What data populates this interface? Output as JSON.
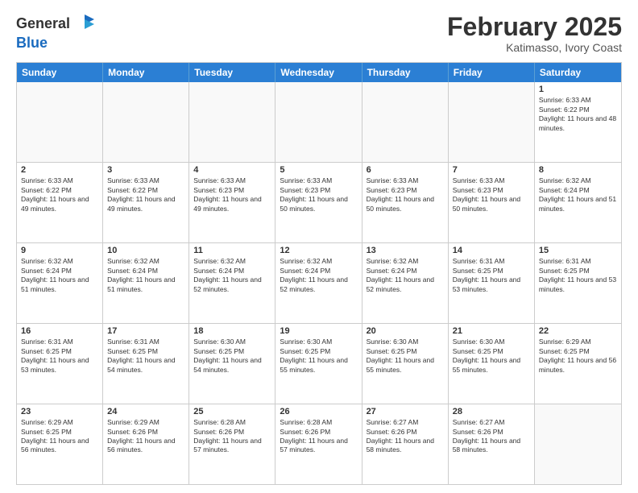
{
  "header": {
    "logo_line1": "General",
    "logo_line2": "Blue",
    "month": "February 2025",
    "location": "Katimasso, Ivory Coast"
  },
  "days_of_week": [
    "Sunday",
    "Monday",
    "Tuesday",
    "Wednesday",
    "Thursday",
    "Friday",
    "Saturday"
  ],
  "rows": [
    [
      {
        "day": "",
        "info": ""
      },
      {
        "day": "",
        "info": ""
      },
      {
        "day": "",
        "info": ""
      },
      {
        "day": "",
        "info": ""
      },
      {
        "day": "",
        "info": ""
      },
      {
        "day": "",
        "info": ""
      },
      {
        "day": "1",
        "info": "Sunrise: 6:33 AM\nSunset: 6:22 PM\nDaylight: 11 hours and 48 minutes."
      }
    ],
    [
      {
        "day": "2",
        "info": "Sunrise: 6:33 AM\nSunset: 6:22 PM\nDaylight: 11 hours and 49 minutes."
      },
      {
        "day": "3",
        "info": "Sunrise: 6:33 AM\nSunset: 6:22 PM\nDaylight: 11 hours and 49 minutes."
      },
      {
        "day": "4",
        "info": "Sunrise: 6:33 AM\nSunset: 6:23 PM\nDaylight: 11 hours and 49 minutes."
      },
      {
        "day": "5",
        "info": "Sunrise: 6:33 AM\nSunset: 6:23 PM\nDaylight: 11 hours and 50 minutes."
      },
      {
        "day": "6",
        "info": "Sunrise: 6:33 AM\nSunset: 6:23 PM\nDaylight: 11 hours and 50 minutes."
      },
      {
        "day": "7",
        "info": "Sunrise: 6:33 AM\nSunset: 6:23 PM\nDaylight: 11 hours and 50 minutes."
      },
      {
        "day": "8",
        "info": "Sunrise: 6:32 AM\nSunset: 6:24 PM\nDaylight: 11 hours and 51 minutes."
      }
    ],
    [
      {
        "day": "9",
        "info": "Sunrise: 6:32 AM\nSunset: 6:24 PM\nDaylight: 11 hours and 51 minutes."
      },
      {
        "day": "10",
        "info": "Sunrise: 6:32 AM\nSunset: 6:24 PM\nDaylight: 11 hours and 51 minutes."
      },
      {
        "day": "11",
        "info": "Sunrise: 6:32 AM\nSunset: 6:24 PM\nDaylight: 11 hours and 52 minutes."
      },
      {
        "day": "12",
        "info": "Sunrise: 6:32 AM\nSunset: 6:24 PM\nDaylight: 11 hours and 52 minutes."
      },
      {
        "day": "13",
        "info": "Sunrise: 6:32 AM\nSunset: 6:24 PM\nDaylight: 11 hours and 52 minutes."
      },
      {
        "day": "14",
        "info": "Sunrise: 6:31 AM\nSunset: 6:25 PM\nDaylight: 11 hours and 53 minutes."
      },
      {
        "day": "15",
        "info": "Sunrise: 6:31 AM\nSunset: 6:25 PM\nDaylight: 11 hours and 53 minutes."
      }
    ],
    [
      {
        "day": "16",
        "info": "Sunrise: 6:31 AM\nSunset: 6:25 PM\nDaylight: 11 hours and 53 minutes."
      },
      {
        "day": "17",
        "info": "Sunrise: 6:31 AM\nSunset: 6:25 PM\nDaylight: 11 hours and 54 minutes."
      },
      {
        "day": "18",
        "info": "Sunrise: 6:30 AM\nSunset: 6:25 PM\nDaylight: 11 hours and 54 minutes."
      },
      {
        "day": "19",
        "info": "Sunrise: 6:30 AM\nSunset: 6:25 PM\nDaylight: 11 hours and 55 minutes."
      },
      {
        "day": "20",
        "info": "Sunrise: 6:30 AM\nSunset: 6:25 PM\nDaylight: 11 hours and 55 minutes."
      },
      {
        "day": "21",
        "info": "Sunrise: 6:30 AM\nSunset: 6:25 PM\nDaylight: 11 hours and 55 minutes."
      },
      {
        "day": "22",
        "info": "Sunrise: 6:29 AM\nSunset: 6:25 PM\nDaylight: 11 hours and 56 minutes."
      }
    ],
    [
      {
        "day": "23",
        "info": "Sunrise: 6:29 AM\nSunset: 6:25 PM\nDaylight: 11 hours and 56 minutes."
      },
      {
        "day": "24",
        "info": "Sunrise: 6:29 AM\nSunset: 6:26 PM\nDaylight: 11 hours and 56 minutes."
      },
      {
        "day": "25",
        "info": "Sunrise: 6:28 AM\nSunset: 6:26 PM\nDaylight: 11 hours and 57 minutes."
      },
      {
        "day": "26",
        "info": "Sunrise: 6:28 AM\nSunset: 6:26 PM\nDaylight: 11 hours and 57 minutes."
      },
      {
        "day": "27",
        "info": "Sunrise: 6:27 AM\nSunset: 6:26 PM\nDaylight: 11 hours and 58 minutes."
      },
      {
        "day": "28",
        "info": "Sunrise: 6:27 AM\nSunset: 6:26 PM\nDaylight: 11 hours and 58 minutes."
      },
      {
        "day": "",
        "info": ""
      }
    ]
  ]
}
